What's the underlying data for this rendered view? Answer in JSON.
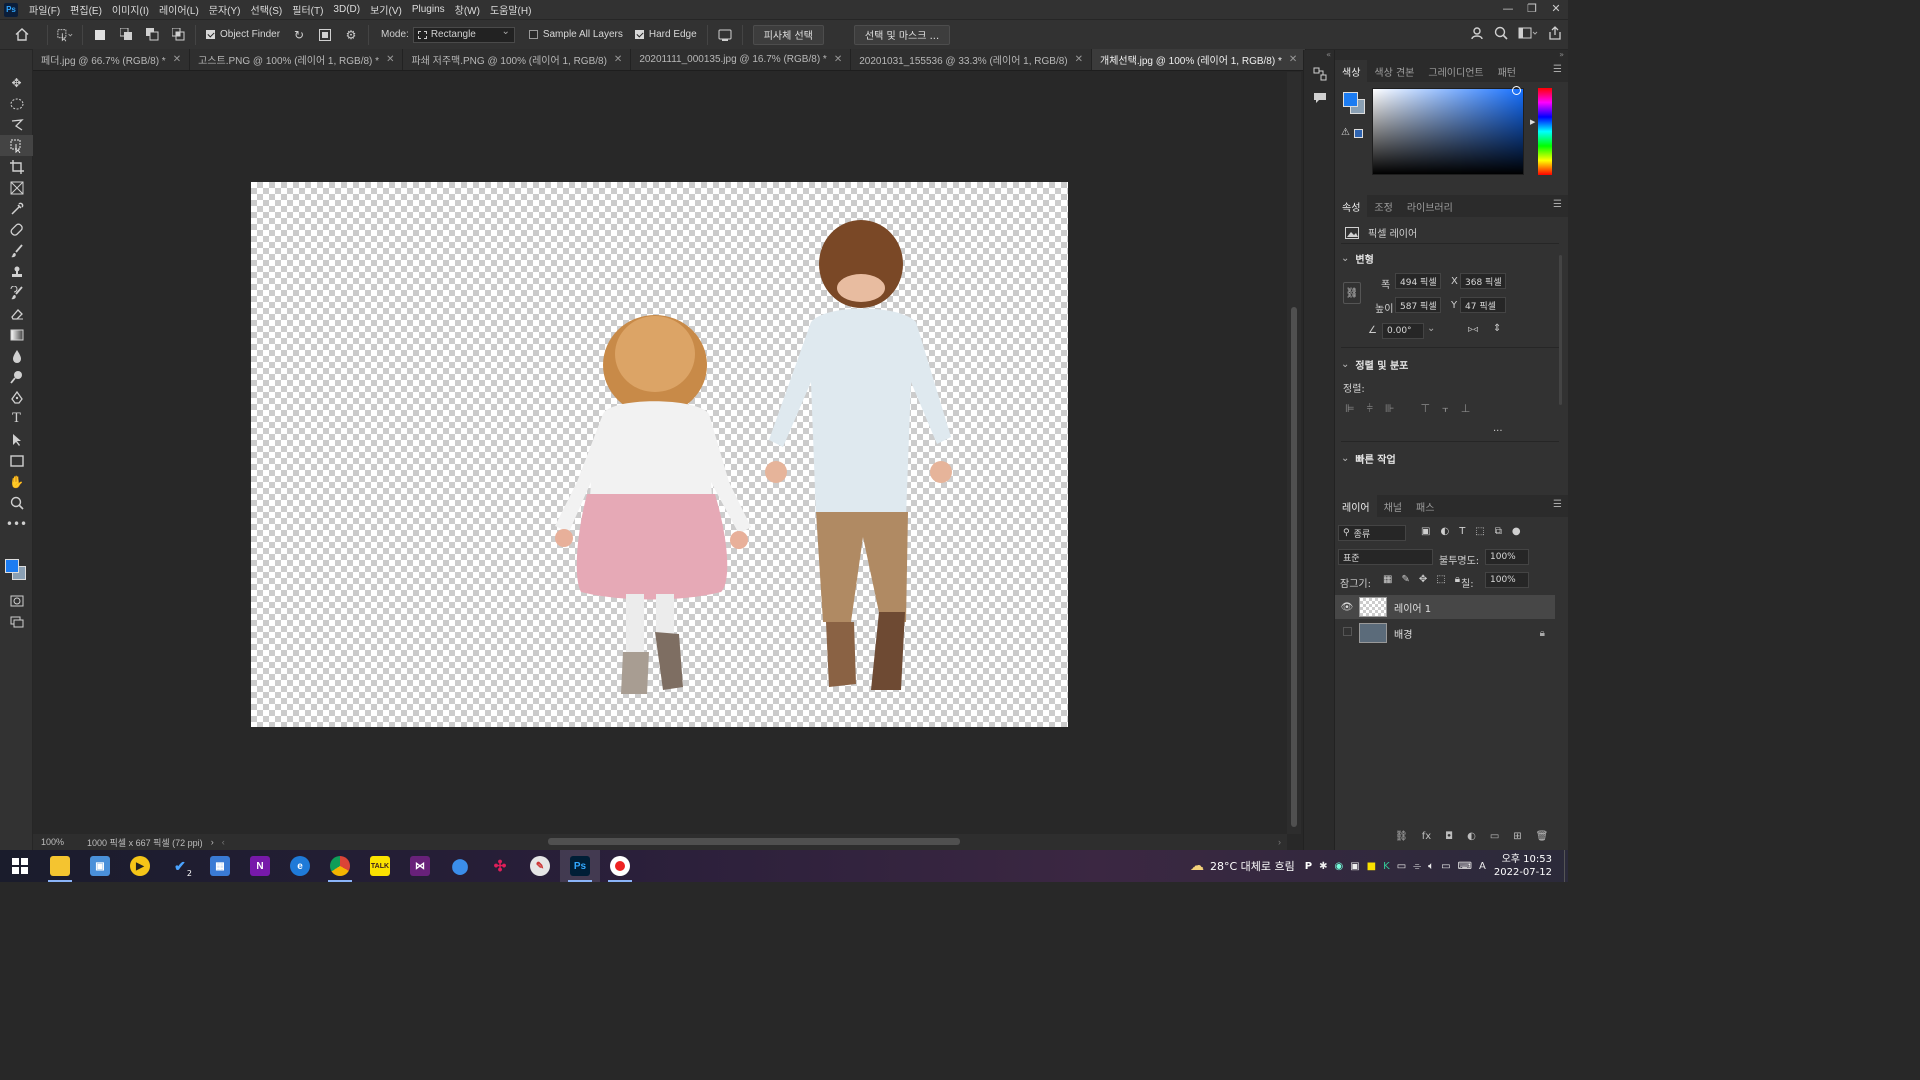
{
  "menubar": {
    "logo": "Ps",
    "items": [
      "파일(F)",
      "편집(E)",
      "이미지(I)",
      "레이어(L)",
      "문자(Y)",
      "선택(S)",
      "필터(T)",
      "3D(D)",
      "보기(V)",
      "Plugins",
      "창(W)",
      "도움말(H)"
    ],
    "window_controls": [
      "—",
      "❐",
      "✕"
    ]
  },
  "options": {
    "object_finder": "Object Finder",
    "mode_label": "Mode:",
    "mode_value": "Rectangle",
    "sample_all_layers": "Sample All Layers",
    "hard_edge": "Hard Edge",
    "select_subject": "피사체 선택",
    "select_and_mask": "선택 및 마스크 ..."
  },
  "tabs": [
    {
      "label": "페더.jpg @ 66.7% (RGB/8) *",
      "active": false
    },
    {
      "label": "고스트.PNG @ 100% (레이어 1, RGB/8) *",
      "active": false
    },
    {
      "label": "파쇄 저주맥.PNG @ 100% (레이어 1, RGB/8)",
      "active": false
    },
    {
      "label": "20201111_000135.jpg @ 16.7% (RGB/8) *",
      "active": false
    },
    {
      "label": "20201031_155536 @ 33.3% (레이어 1, RGB/8)",
      "active": false
    },
    {
      "label": "개체선택.jpg @ 100% (레이어 1, RGB/8) *",
      "active": true
    }
  ],
  "statusbar": {
    "zoom": "100%",
    "doc_info": "1000 픽셀 x 667 픽셀 (72 ppi)"
  },
  "color_panel": {
    "tabs": [
      "색상",
      "색상 견본",
      "그레이디언트",
      "패턴"
    ],
    "foreground": "#1c7cf2",
    "background": "#8aa0b4"
  },
  "properties": {
    "tabs": [
      "속성",
      "조정",
      "라이브러리"
    ],
    "layer_type": "픽셀 레이어",
    "transform_title": "변형",
    "width_label": "폭",
    "width_value": "494 픽셀",
    "height_label": "높이",
    "height_value": "587 픽셀",
    "x_label": "X",
    "x_value": "368 픽셀",
    "y_label": "Y",
    "y_value": "47 픽셀",
    "angle_value": "0.00°",
    "align_title": "정렬 및 분포",
    "align_label": "정렬:",
    "quick_actions_title": "빠른 작업",
    "more": "..."
  },
  "layers": {
    "tabs": [
      "레이어",
      "채널",
      "패스"
    ],
    "filter_label": "종류",
    "blend_mode": "표준",
    "opacity_label": "불투명도:",
    "opacity_value": "100%",
    "lock_label": "잠그기:",
    "fill_label": "칠:",
    "fill_value": "100%",
    "items": [
      {
        "name": "레이어 1",
        "selected": true,
        "visible": true
      },
      {
        "name": "배경",
        "selected": false,
        "visible": false,
        "locked": true
      }
    ]
  },
  "taskbar": {
    "weather": "28°C 대체로 흐림",
    "time": "오후 10:53",
    "date": "2022-07-12",
    "ime": "A",
    "badge_count": "2"
  }
}
